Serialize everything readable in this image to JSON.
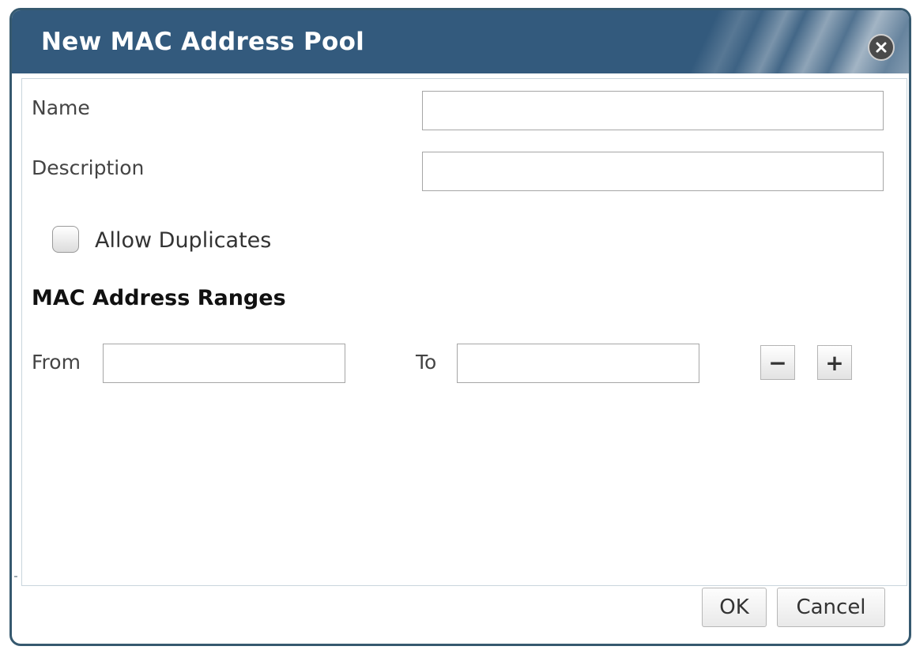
{
  "dialog": {
    "title": "New MAC Address Pool",
    "close_icon": "close-icon",
    "colors": {
      "titlebar": "#335a7d",
      "border": "#36596f"
    }
  },
  "form": {
    "name_label": "Name",
    "name_value": "",
    "description_label": "Description",
    "description_value": "",
    "allow_duplicates_label": "Allow Duplicates",
    "allow_duplicates_checked": false,
    "ranges_heading": "MAC Address Ranges",
    "from_label": "From",
    "from_value": "",
    "to_label": "To",
    "to_value": "",
    "remove_range_label": "−",
    "add_range_label": "+"
  },
  "footer": {
    "ok_label": "OK",
    "cancel_label": "Cancel"
  }
}
